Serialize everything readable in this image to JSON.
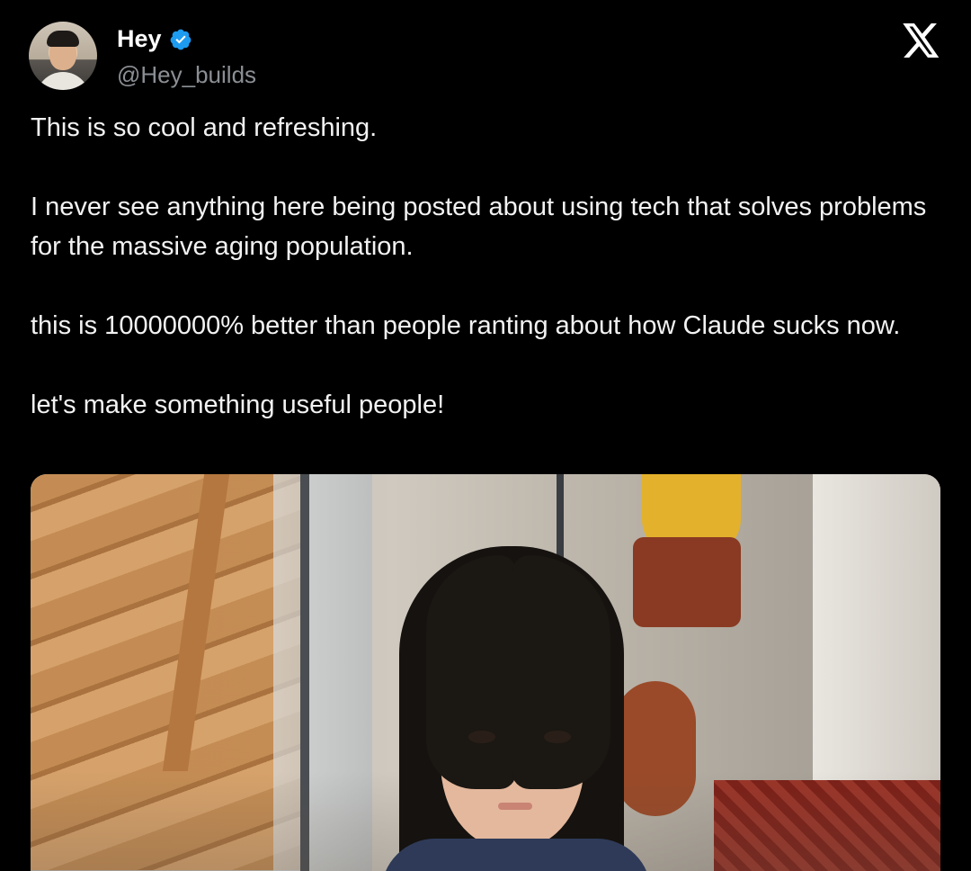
{
  "author": {
    "name": "Hey",
    "handle": "@Hey_builds",
    "verified_color": "#1d9bf0"
  },
  "header": {
    "logo_icon": "x-logo-icon"
  },
  "tweet": {
    "paragraphs": [
      "This is so cool and refreshing.",
      "I never see anything here being posted about using tech that solves problems for the massive aging population.",
      "this is 10000000% better than people ranting about how Claude sucks now.",
      "let's make something useful people!"
    ]
  },
  "media": {
    "type": "photo"
  },
  "colors": {
    "background": "#000000",
    "text": "#f2f2f2",
    "handle": "#8b8f94"
  }
}
